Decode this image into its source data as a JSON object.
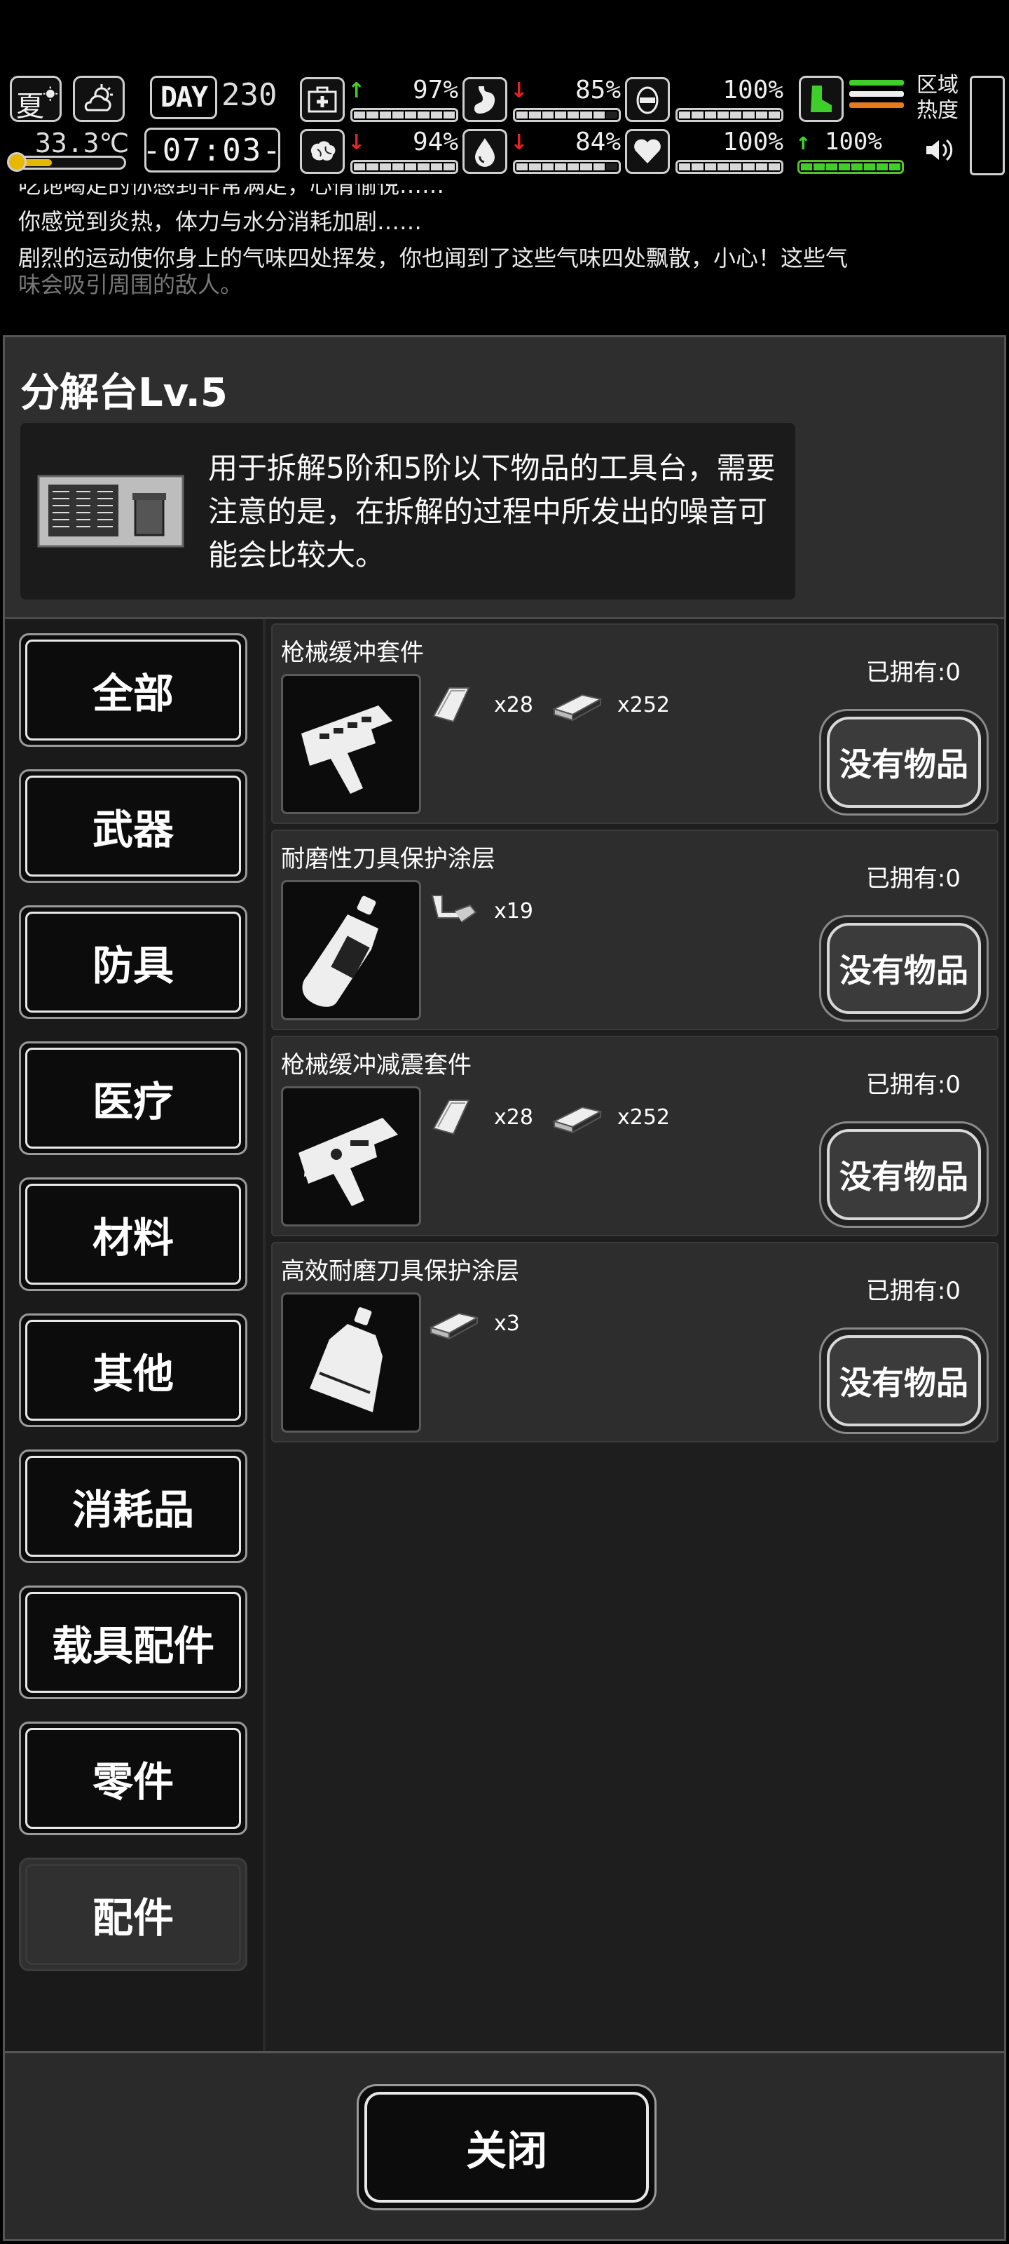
{
  "hud": {
    "season": "夏",
    "temperature": "33.3℃",
    "temperature_level": 0.35,
    "day_label": "DAY",
    "day_number": "230",
    "time": "-07:03-",
    "stats": [
      {
        "icon": "medkit-icon",
        "arrow": "up",
        "percent": "97%",
        "level": 0.97
      },
      {
        "icon": "stomach-icon",
        "arrow": "down",
        "percent": "85%",
        "level": 0.85
      },
      {
        "icon": "mask-icon",
        "arrow": "none",
        "percent": "100%",
        "level": 1.0
      },
      {
        "icon": "brain-icon",
        "arrow": "down",
        "percent": "94%",
        "level": 0.94
      },
      {
        "icon": "water-drop-icon",
        "arrow": "down",
        "percent": "84%",
        "level": 0.84
      },
      {
        "icon": "heart-icon",
        "arrow": "none",
        "percent": "100%",
        "level": 1.0
      }
    ],
    "fatigue_percent": "100%",
    "fatigue_level": 1.0,
    "region_label": "区域热度",
    "colors": {
      "up": "#3fd12a",
      "down": "#e52222",
      "green": "#3fcf2a",
      "orange": "#e87a1c",
      "thermo": "#e8b800"
    }
  },
  "log": [
    "吃饱喝足的你感到非常满足，心情愉悦……",
    "你感觉到炎热，体力与水分消耗加剧……",
    "剧烈的运动使你身上的气味四处挥发，你也闻到了这些气味四处飘散，小心！这些气",
    "味会吸引周围的敌人。"
  ],
  "station": {
    "title": "分解台Lv.5",
    "description": "用于拆解5阶和5阶以下物品的工具台，需要注意的是，在拆解的过程中所发出的噪音可能会比较大。"
  },
  "categories": [
    "全部",
    "武器",
    "防具",
    "医疗",
    "材料",
    "其他",
    "消耗品",
    "载具配件",
    "零件",
    "配件"
  ],
  "active_category": "配件",
  "items": [
    {
      "name": "枪械缓冲套件",
      "owned": "已拥有:0",
      "button": "没有物品",
      "materials": [
        {
          "icon": "metal-sheet-icon",
          "qty": "x28"
        },
        {
          "icon": "metal-bar-icon",
          "qty": "x252"
        }
      ]
    },
    {
      "name": "耐磨性刀具保护涂层",
      "owned": "已拥有:0",
      "button": "没有物品",
      "materials": [
        {
          "icon": "pipe-fitting-icon",
          "qty": "x19"
        }
      ]
    },
    {
      "name": "枪械缓冲减震套件",
      "owned": "已拥有:0",
      "button": "没有物品",
      "materials": [
        {
          "icon": "metal-sheet-icon",
          "qty": "x28"
        },
        {
          "icon": "metal-bar-icon",
          "qty": "x252"
        }
      ]
    },
    {
      "name": "高效耐磨刀具保护涂层",
      "owned": "已拥有:0",
      "button": "没有物品",
      "materials": [
        {
          "icon": "metal-bar-icon",
          "qty": "x3"
        }
      ]
    }
  ],
  "close_label": "关闭"
}
